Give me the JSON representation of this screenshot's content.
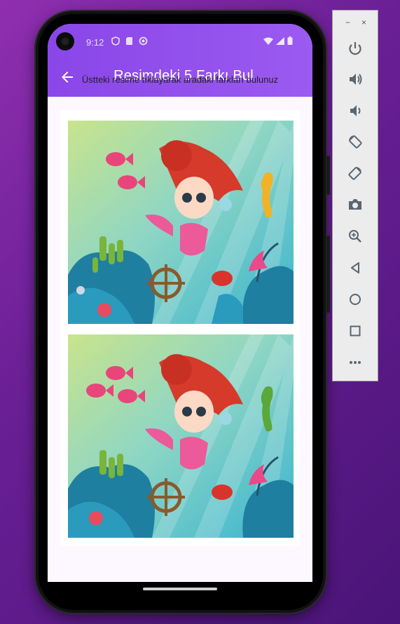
{
  "status_bar": {
    "time": "9:12",
    "left_icons": [
      "shield-icon",
      "sim-card-icon",
      "sync-icon"
    ],
    "right_icons": [
      "wifi-icon",
      "signal-icon",
      "battery-icon"
    ]
  },
  "app_bar": {
    "back_icon": "arrow-back-icon",
    "title": "Resimdeki 5 Farkı Bul"
  },
  "instruction": "Üstteki resime tıklayarak aradaki farkları bulunuz",
  "images": {
    "top": {
      "alt": "mermaid-original"
    },
    "bottom": {
      "alt": "mermaid-differences"
    }
  },
  "emulator_toolbar": {
    "window_controls": [
      "minimize-icon",
      "close-icon"
    ],
    "minimize_glyph": "−",
    "close_glyph": "×",
    "buttons": [
      "power-icon",
      "volume-up-icon",
      "volume-down-icon",
      "rotate-left-icon",
      "rotate-right-icon",
      "camera-icon",
      "zoom-icon",
      "back-icon",
      "home-icon",
      "overview-icon",
      "more-icon"
    ]
  },
  "colors": {
    "app_bar": "#8a46e8",
    "background_gradient_start": "#8f2fb0",
    "background_gradient_end": "#4a1478"
  }
}
